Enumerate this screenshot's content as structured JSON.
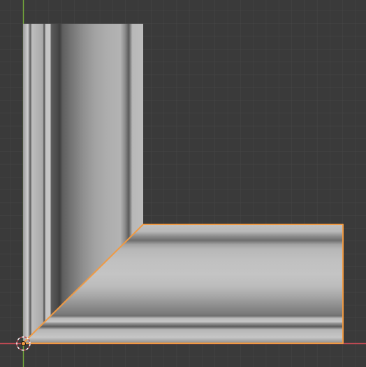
{
  "viewport": {
    "view": "3d-viewport-top-orthographic",
    "background_color": "#3a3a3a",
    "grid_color": "#474747",
    "x_axis_color": "#c94a55",
    "y_axis_color": "#74a93a",
    "selection_outline_color": "#f09a43"
  },
  "scene_objects": [
    {
      "name": "vertical-molding-piece",
      "selected": false
    },
    {
      "name": "horizontal-molding-piece",
      "selected": true
    }
  ],
  "origin_marker": {
    "icon": "object-origin-icon"
  }
}
